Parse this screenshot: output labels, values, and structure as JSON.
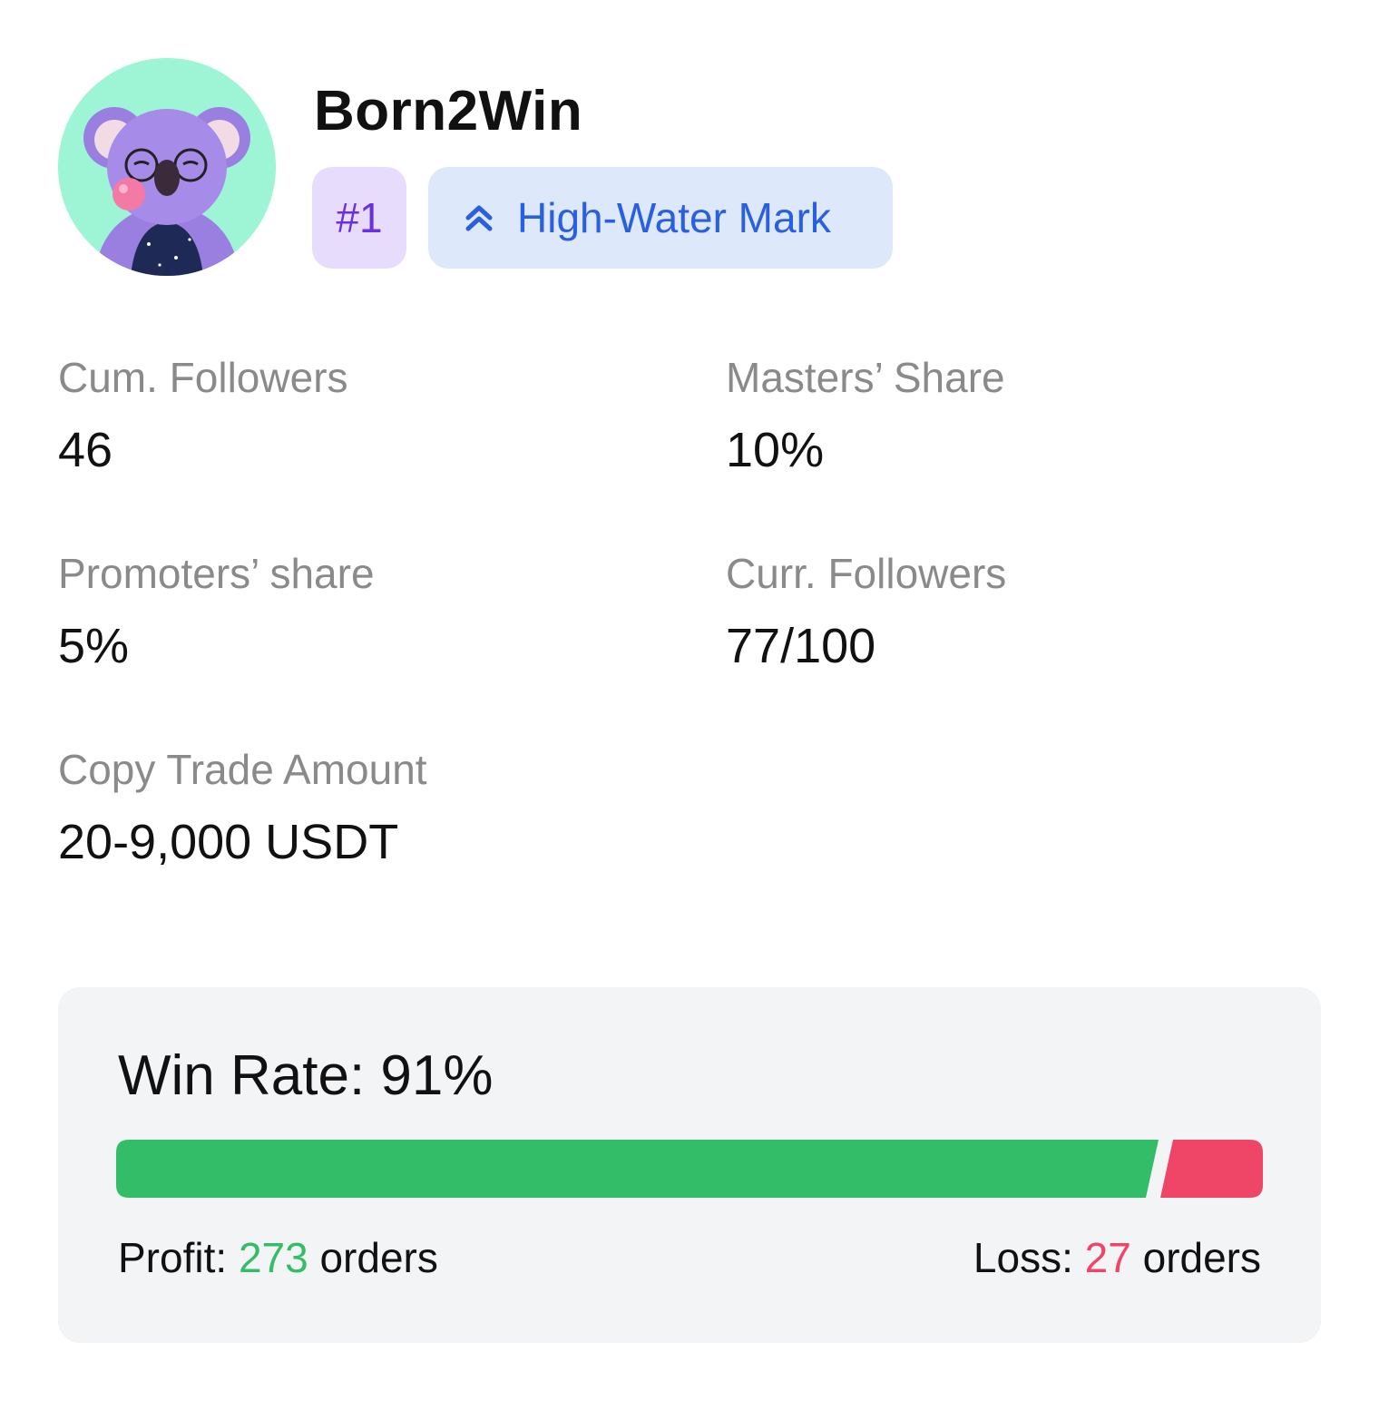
{
  "profile": {
    "username": "Born2Win",
    "avatar_alt": "koala-avatar",
    "rank_badge": "#1",
    "mode_badge": {
      "icon": "double-chevron-up-icon",
      "label": "High-Water Mark"
    }
  },
  "stats": {
    "cum_followers": {
      "label": "Cum. Followers",
      "value": "46"
    },
    "masters_share": {
      "label": "Masters’ Share",
      "value": "10%"
    },
    "promoters_share": {
      "label": "Promoters’ share",
      "value": "5%"
    },
    "curr_followers": {
      "label": "Curr. Followers",
      "value": "77/100"
    },
    "copy_trade_amount": {
      "label": "Copy Trade Amount",
      "value": "20-9,000 USDT"
    }
  },
  "win_rate": {
    "title": "Win Rate: 91%",
    "win_fraction": 0.91,
    "profit": {
      "prefix": "Profit: ",
      "count": "273",
      "suffix": " orders"
    },
    "loss": {
      "prefix": "Loss: ",
      "count": "27",
      "suffix": " orders"
    },
    "colors": {
      "profit": "#34bd68",
      "loss": "#ef4566"
    }
  },
  "colors": {
    "avatar_bg": "#9ef5d6",
    "rank_bg": "#e8dcfd",
    "rank_text": "#6a2fe0",
    "mode_bg": "#dde8fb",
    "mode_text": "#2a5fe0"
  }
}
